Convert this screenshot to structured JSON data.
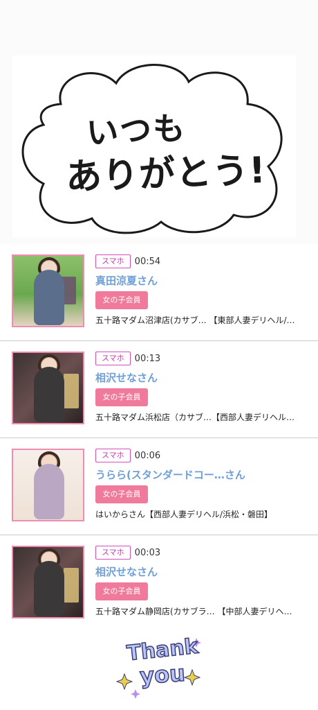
{
  "hero": {
    "line1": "いつも",
    "line2": "ありがとう!"
  },
  "entries": [
    {
      "device": "スマホ",
      "time": "00:54",
      "name": "真田涼夏さん",
      "member": "女の子会員",
      "shop": "五十路マダム沼津店(カサブ… 【東部人妻デリヘル/…"
    },
    {
      "device": "スマホ",
      "time": "00:13",
      "name": "相沢せなさん",
      "member": "女の子会員",
      "shop": "五十路マダム浜松店（カサブ…【西部人妻デリヘル…"
    },
    {
      "device": "スマホ",
      "time": "00:06",
      "name": "うらら(スタンダードコー…さん",
      "member": "女の子会員",
      "shop": "はいからさん【西部人妻デリヘル/浜松・磐田】"
    },
    {
      "device": "スマホ",
      "time": "00:03",
      "name": "相沢せなさん",
      "member": "女の子会員",
      "shop": "五十路マダム静岡店(カサブラ… 【中部人妻デリヘ…"
    }
  ],
  "footer": {
    "line1": "Thank",
    "line2": "you"
  }
}
